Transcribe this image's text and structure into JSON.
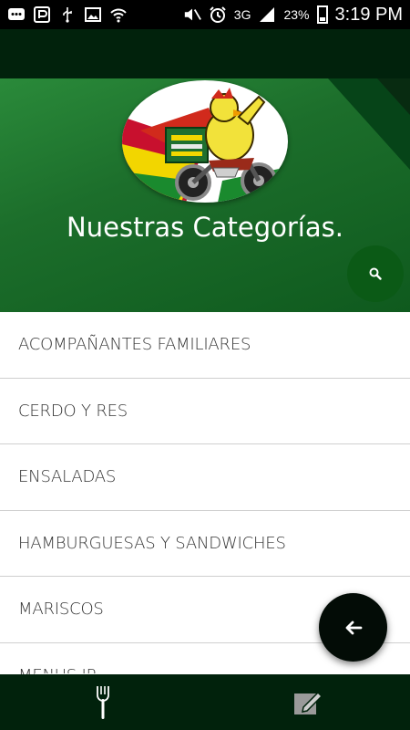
{
  "status_bar": {
    "battery_percent": "23%",
    "network": "3G",
    "time": "3:19 PM"
  },
  "header": {
    "title": "Nuestras Categorías.",
    "logo_icon": "chicken-motorcycle-delivery-logo"
  },
  "search_button": {
    "icon": "search-icon"
  },
  "categories": [
    "ACOMPAÑANTES FAMILIARES",
    "CERDO Y RES",
    "ENSALADAS",
    "HAMBURGUESAS Y SANDWICHES",
    "MARISCOS",
    "MENUS JR"
  ],
  "back_button": {
    "icon": "arrow-left-icon"
  },
  "bottom_nav": {
    "items": [
      {
        "icon": "fork-icon",
        "active": true
      },
      {
        "icon": "edit-icon",
        "active": false
      }
    ]
  },
  "colors": {
    "toolbar": "#01220c",
    "header_green": "#1c6e2b",
    "fab_dark": "#030c06",
    "search_fab": "#0b5a16"
  }
}
